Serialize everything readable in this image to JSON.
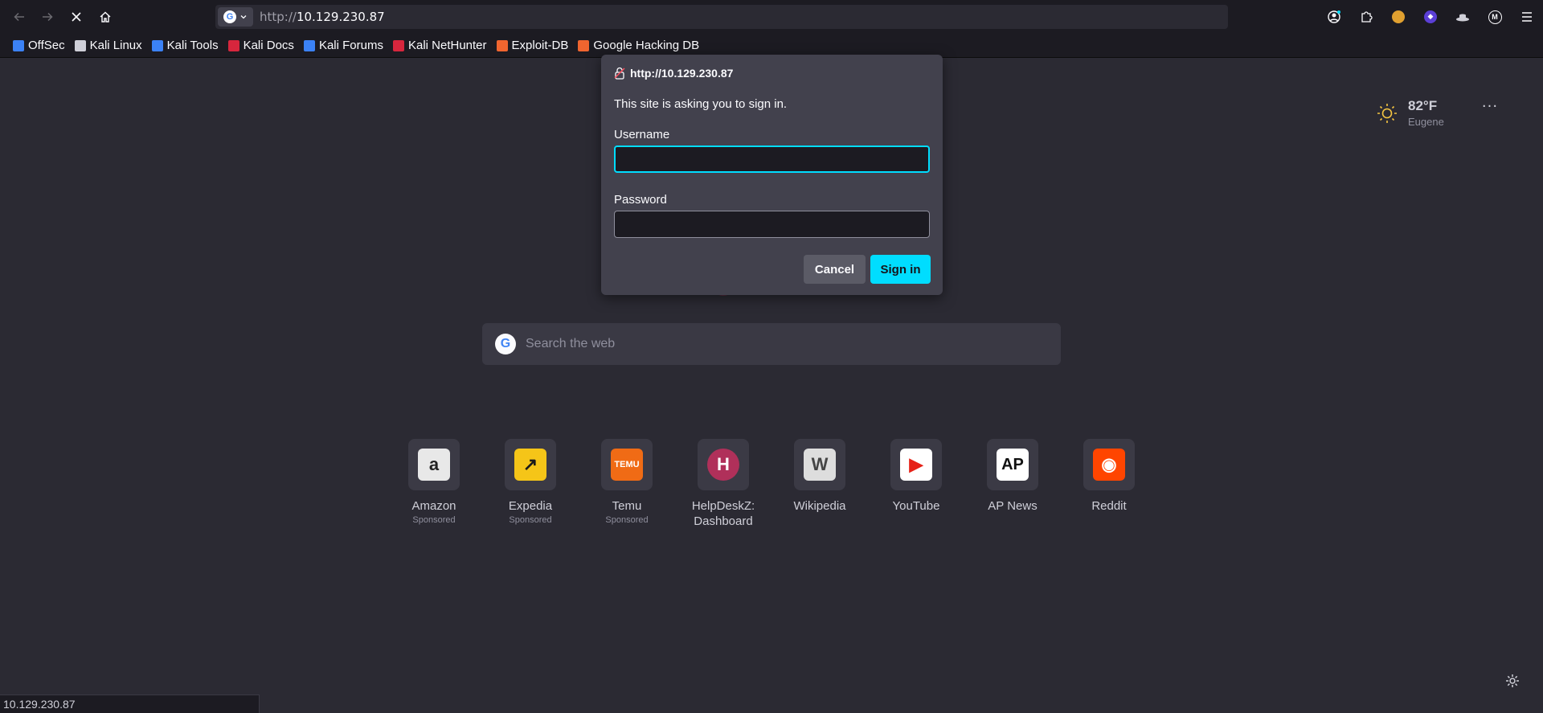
{
  "toolbar": {
    "url_protocol": "http://",
    "url_host": "10.129.230.87"
  },
  "bookmarks": [
    {
      "label": "OffSec",
      "icon": "offsec-icon",
      "color": "#3b82f6"
    },
    {
      "label": "Kali Linux",
      "icon": "kali-dragon-icon",
      "color": "#cfcfd8"
    },
    {
      "label": "Kali Tools",
      "icon": "kali-tools-icon",
      "color": "#3b82f6"
    },
    {
      "label": "Kali Docs",
      "icon": "kali-docs-icon",
      "color": "#d7263d"
    },
    {
      "label": "Kali Forums",
      "icon": "kali-forums-icon",
      "color": "#3b82f6"
    },
    {
      "label": "Kali NetHunter",
      "icon": "nethunter-icon",
      "color": "#d7263d"
    },
    {
      "label": "Exploit-DB",
      "icon": "exploit-db-icon",
      "color": "#f0652f"
    },
    {
      "label": "Google Hacking DB",
      "icon": "ghdb-icon",
      "color": "#f0652f"
    }
  ],
  "weather": {
    "temp": "82°F",
    "city": "Eugene"
  },
  "search": {
    "placeholder": "Search the web"
  },
  "tiles": [
    {
      "label": "Amazon",
      "sub": "Sponsored",
      "icon": "amazon-icon",
      "bg": "#e8e8e8",
      "glyph": "a",
      "fg": "#222"
    },
    {
      "label": "Expedia",
      "sub": "Sponsored",
      "icon": "expedia-icon",
      "bg": "#f5c518",
      "glyph": "↗",
      "fg": "#1a1a1a"
    },
    {
      "label": "Temu",
      "sub": "Sponsored",
      "icon": "temu-icon",
      "bg": "#f06b15",
      "glyph": "TEMU",
      "fg": "#fff"
    },
    {
      "label": "HelpDeskZ: Dashboard",
      "sub": "",
      "icon": "letter-h-icon",
      "bg": "#b0305a",
      "glyph": "H",
      "fg": "#fff"
    },
    {
      "label": "Wikipedia",
      "sub": "",
      "icon": "wikipedia-icon",
      "bg": "#dddddd",
      "glyph": "W",
      "fg": "#444"
    },
    {
      "label": "YouTube",
      "sub": "",
      "icon": "youtube-icon",
      "bg": "#ffffff",
      "glyph": "▶",
      "fg": "#e62117"
    },
    {
      "label": "AP News",
      "sub": "",
      "icon": "ap-news-icon",
      "bg": "#ffffff",
      "glyph": "AP",
      "fg": "#111"
    },
    {
      "label": "Reddit",
      "sub": "",
      "icon": "reddit-icon",
      "bg": "#ff4500",
      "glyph": "◉",
      "fg": "#fff"
    }
  ],
  "status_bar": {
    "text": "10.129.230.87"
  },
  "dialog": {
    "host": "http://10.129.230.87",
    "message": "This site is asking you to sign in.",
    "username_label": "Username",
    "username_value": "",
    "password_label": "Password",
    "password_value": "",
    "cancel_label": "Cancel",
    "signin_label": "Sign in",
    "accent": "#00ddff"
  }
}
